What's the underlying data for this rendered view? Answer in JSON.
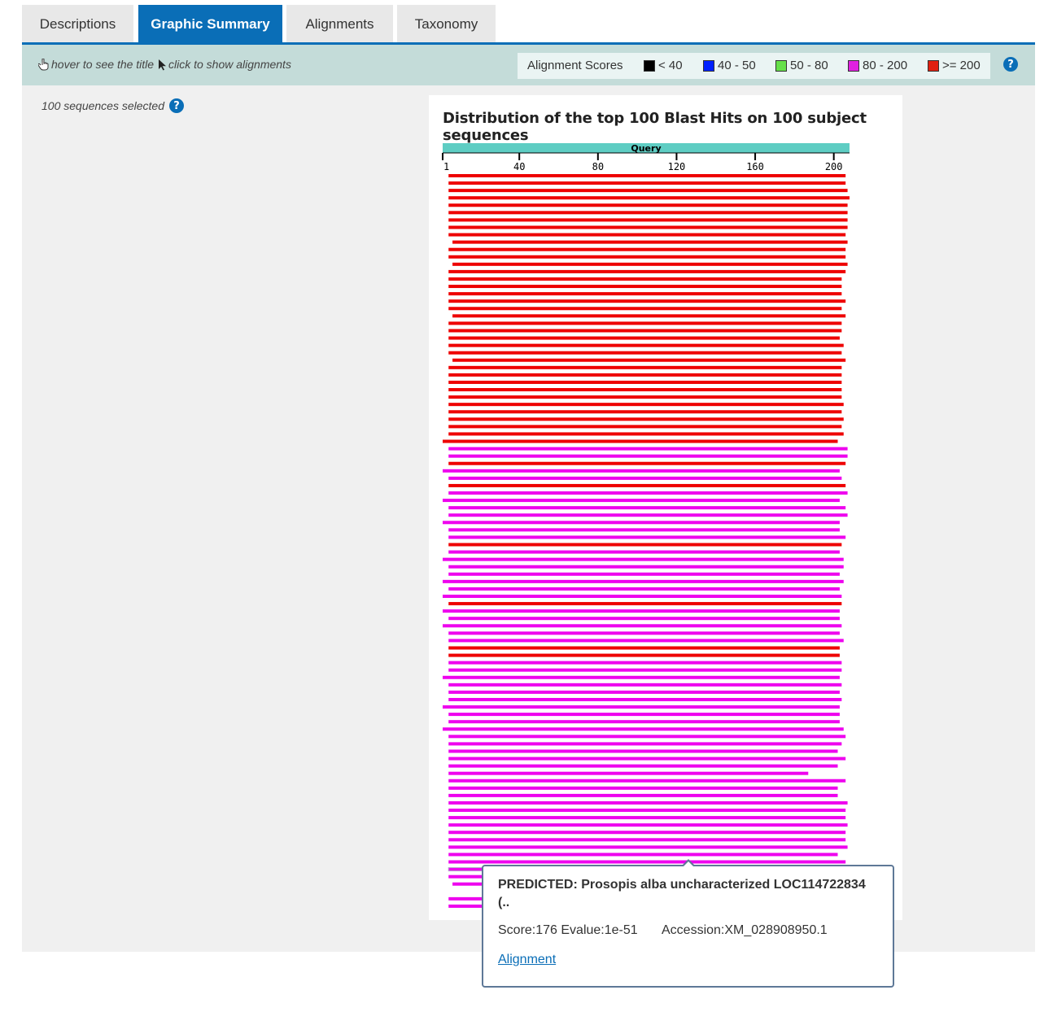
{
  "tabs": [
    {
      "label": "Descriptions"
    },
    {
      "label": "Graphic Summary",
      "active": true
    },
    {
      "label": "Alignments"
    },
    {
      "label": "Taxonomy"
    }
  ],
  "toolbar": {
    "hover_hint": "hover to see the title",
    "click_hint": "click to show alignments",
    "legend_label": "Alignment Scores",
    "legend": [
      {
        "label": "< 40",
        "color": "#000000"
      },
      {
        "label": "40 - 50",
        "color": "#0020ff"
      },
      {
        "label": "50 - 80",
        "color": "#66e04a"
      },
      {
        "label": "80 - 200",
        "color": "#e020e0"
      },
      {
        "label": ">= 200",
        "color": "#e02010"
      }
    ],
    "help_icon": "?"
  },
  "selection": {
    "text": "100 sequences selected",
    "help_icon": "?"
  },
  "chart_data": {
    "type": "bar",
    "title": "Distribution of the top 100 Blast Hits on 100 subject sequences",
    "query_label": "Query",
    "query_length": 208,
    "ticks": [
      1,
      40,
      80,
      120,
      160,
      200
    ],
    "colors": {
      "red": "#ee0000",
      "magenta": "#ee00ee"
    },
    "hits": [
      {
        "start": 4,
        "end": 206,
        "color": "red"
      },
      {
        "start": 4,
        "end": 206,
        "color": "red"
      },
      {
        "start": 4,
        "end": 207,
        "color": "red"
      },
      {
        "start": 4,
        "end": 208,
        "color": "red"
      },
      {
        "start": 4,
        "end": 207,
        "color": "red"
      },
      {
        "start": 4,
        "end": 207,
        "color": "red"
      },
      {
        "start": 4,
        "end": 207,
        "color": "red"
      },
      {
        "start": 4,
        "end": 207,
        "color": "red"
      },
      {
        "start": 4,
        "end": 206,
        "color": "red"
      },
      {
        "start": 6,
        "end": 207,
        "color": "red"
      },
      {
        "start": 4,
        "end": 206,
        "color": "red"
      },
      {
        "start": 4,
        "end": 206,
        "color": "red"
      },
      {
        "start": 6,
        "end": 207,
        "color": "red"
      },
      {
        "start": 4,
        "end": 206,
        "color": "red"
      },
      {
        "start": 4,
        "end": 204,
        "color": "red"
      },
      {
        "start": 4,
        "end": 204,
        "color": "red"
      },
      {
        "start": 4,
        "end": 204,
        "color": "red"
      },
      {
        "start": 4,
        "end": 206,
        "color": "red"
      },
      {
        "start": 4,
        "end": 204,
        "color": "red"
      },
      {
        "start": 6,
        "end": 206,
        "color": "red"
      },
      {
        "start": 4,
        "end": 204,
        "color": "red"
      },
      {
        "start": 4,
        "end": 204,
        "color": "red"
      },
      {
        "start": 4,
        "end": 203,
        "color": "red"
      },
      {
        "start": 4,
        "end": 205,
        "color": "red"
      },
      {
        "start": 4,
        "end": 204,
        "color": "red"
      },
      {
        "start": 6,
        "end": 206,
        "color": "red"
      },
      {
        "start": 4,
        "end": 204,
        "color": "red"
      },
      {
        "start": 4,
        "end": 204,
        "color": "red"
      },
      {
        "start": 4,
        "end": 204,
        "color": "red"
      },
      {
        "start": 4,
        "end": 204,
        "color": "red"
      },
      {
        "start": 4,
        "end": 204,
        "color": "red"
      },
      {
        "start": 4,
        "end": 205,
        "color": "red"
      },
      {
        "start": 4,
        "end": 204,
        "color": "red"
      },
      {
        "start": 4,
        "end": 205,
        "color": "red"
      },
      {
        "start": 4,
        "end": 204,
        "color": "red"
      },
      {
        "start": 4,
        "end": 205,
        "color": "red"
      },
      {
        "start": 1,
        "end": 202,
        "color": "red"
      },
      {
        "start": 4,
        "end": 207,
        "color": "magenta"
      },
      {
        "start": 4,
        "end": 207,
        "color": "magenta"
      },
      {
        "start": 4,
        "end": 206,
        "color": "red"
      },
      {
        "start": 1,
        "end": 203,
        "color": "magenta"
      },
      {
        "start": 4,
        "end": 204,
        "color": "magenta"
      },
      {
        "start": 4,
        "end": 206,
        "color": "red"
      },
      {
        "start": 4,
        "end": 207,
        "color": "magenta"
      },
      {
        "start": 1,
        "end": 203,
        "color": "magenta"
      },
      {
        "start": 4,
        "end": 206,
        "color": "magenta"
      },
      {
        "start": 4,
        "end": 207,
        "color": "magenta"
      },
      {
        "start": 1,
        "end": 203,
        "color": "magenta"
      },
      {
        "start": 4,
        "end": 203,
        "color": "magenta"
      },
      {
        "start": 4,
        "end": 206,
        "color": "magenta"
      },
      {
        "start": 4,
        "end": 204,
        "color": "red"
      },
      {
        "start": 4,
        "end": 203,
        "color": "magenta"
      },
      {
        "start": 1,
        "end": 205,
        "color": "magenta"
      },
      {
        "start": 4,
        "end": 205,
        "color": "magenta"
      },
      {
        "start": 4,
        "end": 203,
        "color": "magenta"
      },
      {
        "start": 1,
        "end": 205,
        "color": "magenta"
      },
      {
        "start": 4,
        "end": 203,
        "color": "magenta"
      },
      {
        "start": 1,
        "end": 204,
        "color": "magenta"
      },
      {
        "start": 4,
        "end": 204,
        "color": "red"
      },
      {
        "start": 1,
        "end": 203,
        "color": "magenta"
      },
      {
        "start": 4,
        "end": 203,
        "color": "magenta"
      },
      {
        "start": 1,
        "end": 204,
        "color": "magenta"
      },
      {
        "start": 4,
        "end": 203,
        "color": "magenta"
      },
      {
        "start": 4,
        "end": 205,
        "color": "magenta"
      },
      {
        "start": 4,
        "end": 203,
        "color": "red"
      },
      {
        "start": 4,
        "end": 203,
        "color": "red"
      },
      {
        "start": 4,
        "end": 204,
        "color": "magenta"
      },
      {
        "start": 4,
        "end": 204,
        "color": "magenta"
      },
      {
        "start": 1,
        "end": 203,
        "color": "magenta"
      },
      {
        "start": 4,
        "end": 204,
        "color": "magenta"
      },
      {
        "start": 4,
        "end": 203,
        "color": "magenta"
      },
      {
        "start": 4,
        "end": 204,
        "color": "magenta"
      },
      {
        "start": 1,
        "end": 203,
        "color": "magenta"
      },
      {
        "start": 4,
        "end": 203,
        "color": "magenta"
      },
      {
        "start": 4,
        "end": 203,
        "color": "magenta"
      },
      {
        "start": 1,
        "end": 205,
        "color": "magenta"
      },
      {
        "start": 4,
        "end": 206,
        "color": "magenta"
      },
      {
        "start": 4,
        "end": 204,
        "color": "magenta"
      },
      {
        "start": 4,
        "end": 202,
        "color": "magenta"
      },
      {
        "start": 4,
        "end": 206,
        "color": "magenta"
      },
      {
        "start": 4,
        "end": 202,
        "color": "magenta"
      },
      {
        "start": 4,
        "end": 187,
        "color": "magenta"
      },
      {
        "start": 4,
        "end": 206,
        "color": "magenta"
      },
      {
        "start": 4,
        "end": 202,
        "color": "magenta"
      },
      {
        "start": 4,
        "end": 202,
        "color": "magenta"
      },
      {
        "start": 4,
        "end": 207,
        "color": "magenta"
      },
      {
        "start": 4,
        "end": 206,
        "color": "magenta"
      },
      {
        "start": 4,
        "end": 206,
        "color": "magenta"
      },
      {
        "start": 4,
        "end": 207,
        "color": "magenta"
      },
      {
        "start": 4,
        "end": 206,
        "color": "magenta"
      },
      {
        "start": 4,
        "end": 206,
        "color": "magenta"
      },
      {
        "start": 4,
        "end": 207,
        "color": "magenta"
      },
      {
        "start": 4,
        "end": 202,
        "color": "magenta"
      },
      {
        "start": 4,
        "end": 206,
        "color": "magenta"
      },
      {
        "start": 4,
        "end": 202,
        "color": "magenta"
      },
      {
        "start": 4,
        "end": 206,
        "color": "magenta"
      },
      {
        "start": 6,
        "end": 168,
        "color": "magenta"
      },
      {
        "start": 46,
        "end": 206,
        "color": "magenta"
      },
      {
        "start": 4,
        "end": 202,
        "color": "magenta"
      },
      {
        "start": 4,
        "end": 202,
        "color": "magenta"
      }
    ]
  },
  "tooltip": {
    "title": "PREDICTED: Prosopis alba uncharacterized LOC114722834 (..",
    "score_line": "Score:176 Evalue:1e-51",
    "accession": "Accession:XM_028908950.1",
    "link": "Alignment"
  }
}
